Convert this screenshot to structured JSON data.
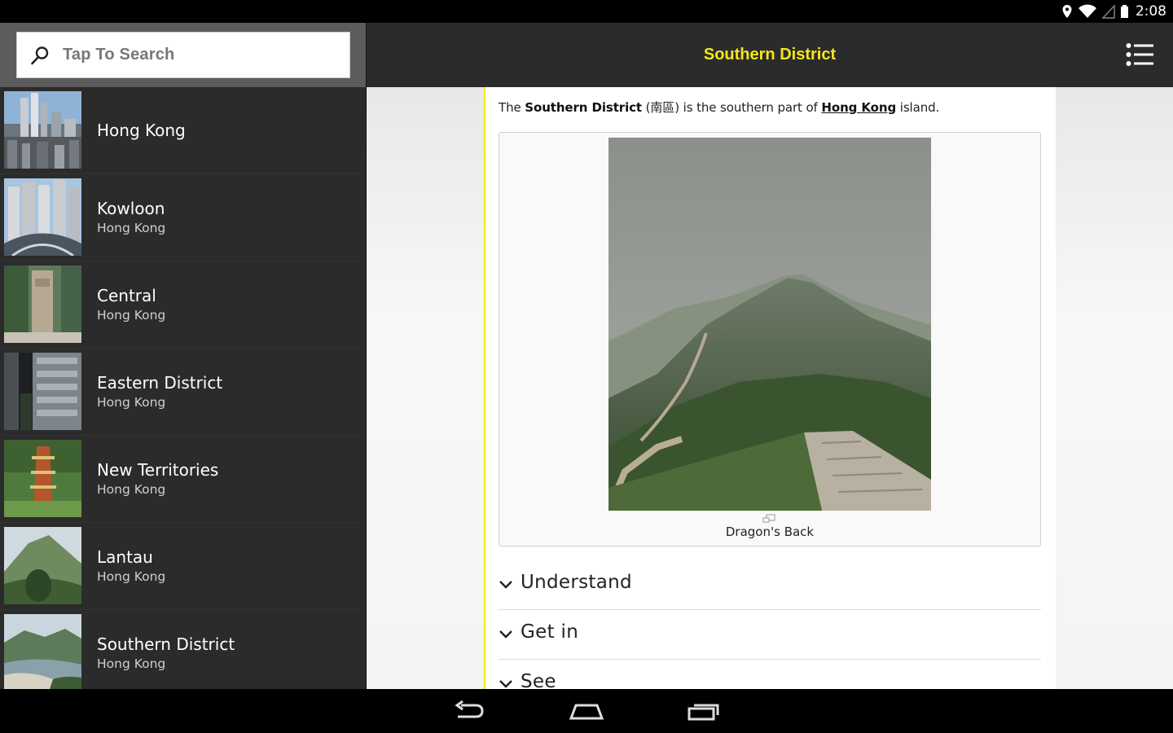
{
  "status": {
    "time": "2:08"
  },
  "search": {
    "placeholder": "Tap To Search"
  },
  "list": [
    {
      "title": "Hong Kong",
      "subtitle": ""
    },
    {
      "title": "Kowloon",
      "subtitle": "Hong Kong"
    },
    {
      "title": "Central",
      "subtitle": "Hong Kong"
    },
    {
      "title": "Eastern District",
      "subtitle": "Hong Kong"
    },
    {
      "title": "New Territories",
      "subtitle": "Hong Kong"
    },
    {
      "title": "Lantau",
      "subtitle": "Hong Kong"
    },
    {
      "title": "Southern District",
      "subtitle": "Hong Kong"
    }
  ],
  "article": {
    "title": "Southern District",
    "intro": {
      "t1": "The ",
      "b1": "Southern District",
      "t2": " (南區) is the southern part of ",
      "link": "Hong Kong",
      "t3": " island."
    },
    "caption": "Dragon's Back",
    "sections": [
      "Understand",
      "Get in",
      "See"
    ]
  },
  "colors": {
    "accent": "#f4e71a",
    "panel": "#2b2b2b"
  }
}
